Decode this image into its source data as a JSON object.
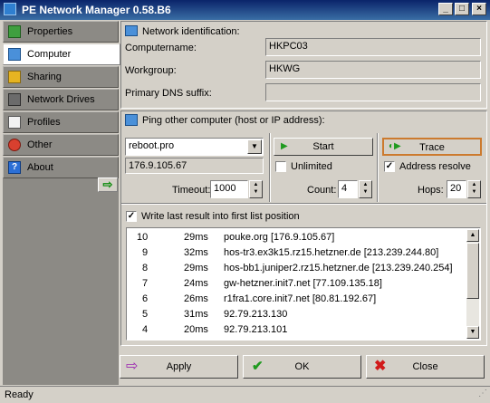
{
  "window": {
    "title": "PE Network Manager 0.58.B6"
  },
  "nav": {
    "items": [
      {
        "label": "Properties",
        "icon": "properties-icon"
      },
      {
        "label": "Computer",
        "icon": "computer-icon"
      },
      {
        "label": "Sharing",
        "icon": "sharing-icon"
      },
      {
        "label": "Network Drives",
        "icon": "network-drives-icon"
      },
      {
        "label": "Profiles",
        "icon": "profiles-icon"
      },
      {
        "label": "Other",
        "icon": "other-icon"
      },
      {
        "label": "About",
        "icon": "about-icon"
      }
    ],
    "selected": "Computer"
  },
  "identification": {
    "heading": "Network identification:",
    "computername_label": "Computername:",
    "computername_value": "HKPC03",
    "workgroup_label": "Workgroup:",
    "workgroup_value": "HKWG",
    "dns_label": "Primary DNS suffix:",
    "dns_value": ""
  },
  "ping": {
    "heading": "Ping other computer (host or IP address):",
    "host_value": "reboot.pro",
    "resolved_ip": "176.9.105.67",
    "start_label": "Start",
    "trace_label": "Trace",
    "unlimited_label": "Unlimited",
    "address_resolve_label": "Address resolve",
    "timeout_label": "Timeout:",
    "timeout_value": "1000",
    "count_label": "Count:",
    "count_value": "4",
    "hops_label": "Hops:",
    "hops_value": "20",
    "write_last_label": "Write last result into first list position"
  },
  "results": [
    {
      "num": "10",
      "time": "29ms",
      "host": "pouke.org [176.9.105.67]"
    },
    {
      "num": "9",
      "time": "32ms",
      "host": "hos-tr3.ex3k15.rz15.hetzner.de [213.239.244.80]"
    },
    {
      "num": "8",
      "time": "29ms",
      "host": "hos-bb1.juniper2.rz15.hetzner.de [213.239.240.254]"
    },
    {
      "num": "7",
      "time": "24ms",
      "host": "gw-hetzner.init7.net [77.109.135.18]"
    },
    {
      "num": "6",
      "time": "26ms",
      "host": "r1fra1.core.init7.net [80.81.192.67]"
    },
    {
      "num": "5",
      "time": "31ms",
      "host": "92.79.213.130"
    },
    {
      "num": "4",
      "time": "20ms",
      "host": "92.79.213.101"
    }
  ],
  "buttons": {
    "apply": "Apply",
    "ok": "OK",
    "close": "Close"
  },
  "status": {
    "text": "Ready"
  },
  "colors": {
    "titlebar": "#0a246a",
    "accent_green": "#1f9a1f",
    "close_red": "#d11a1a",
    "apply_purple": "#9b27b0"
  }
}
